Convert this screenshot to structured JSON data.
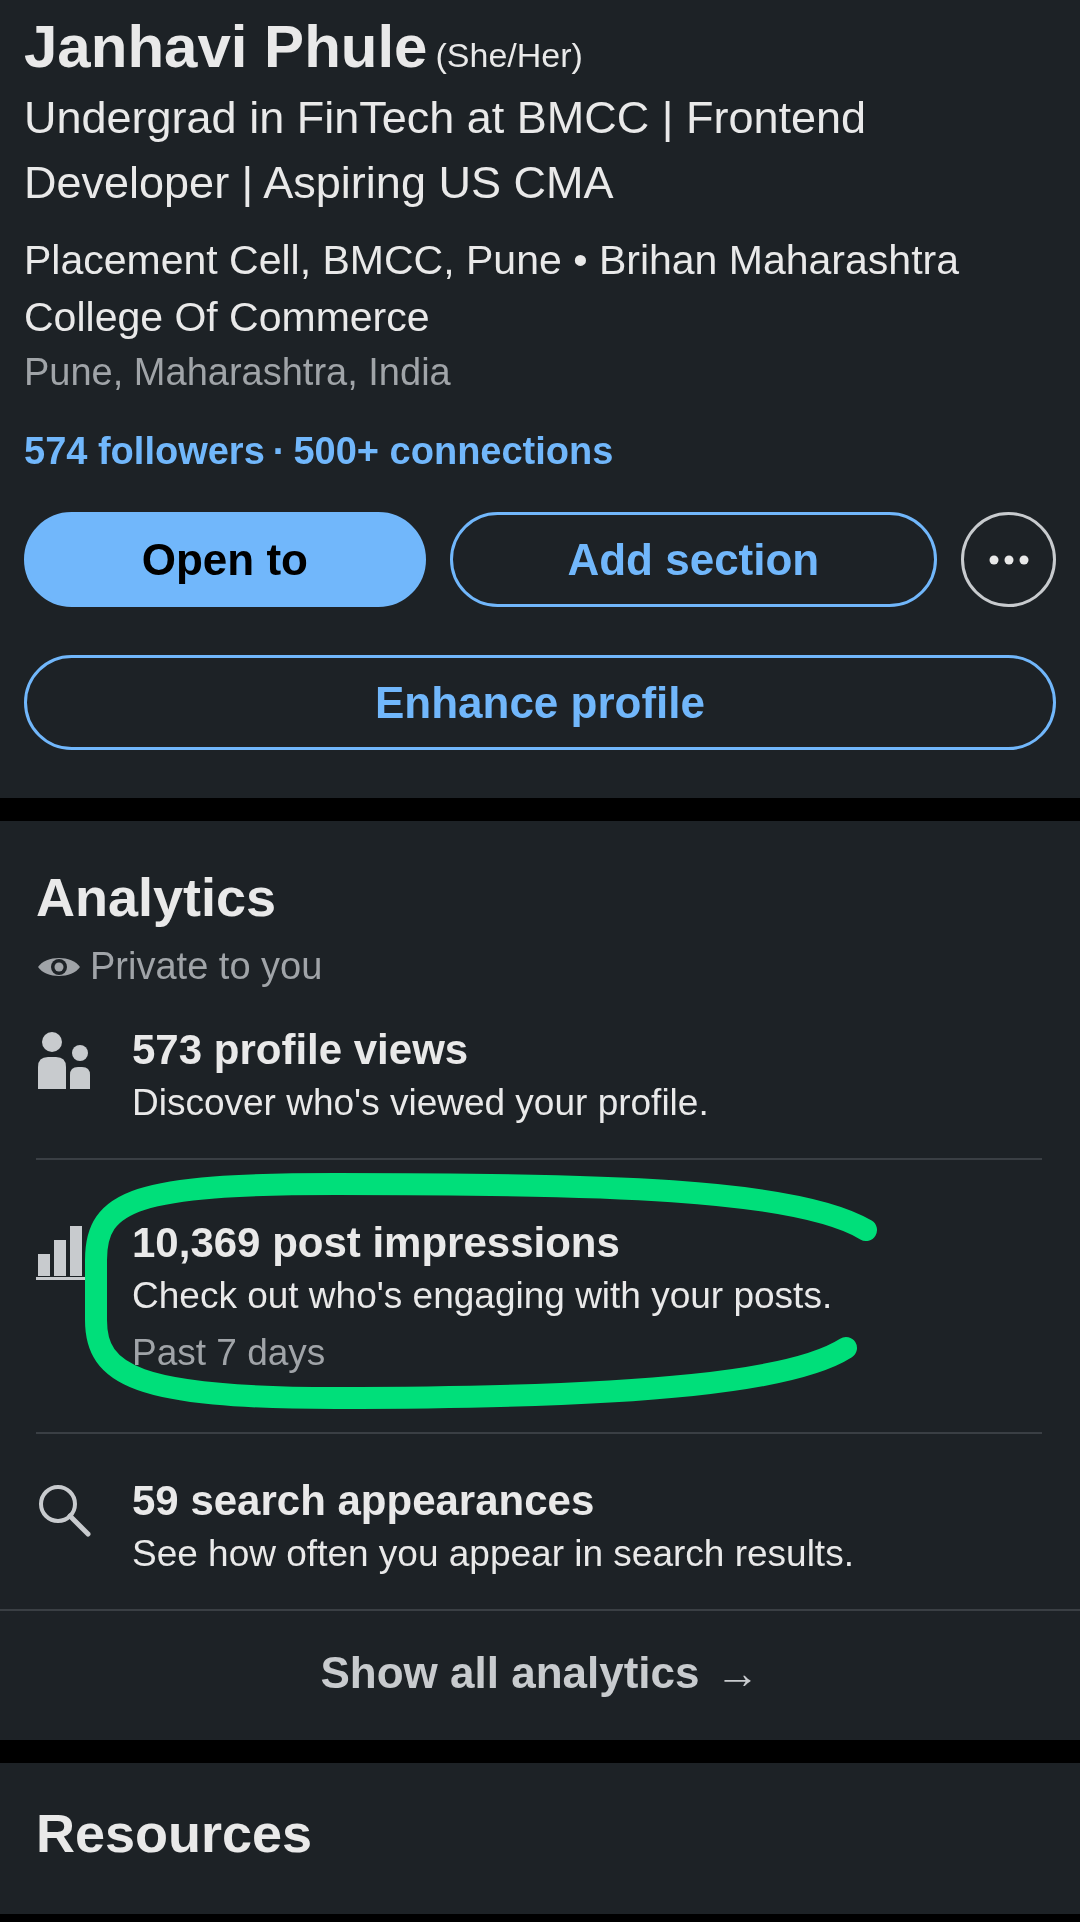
{
  "profile": {
    "name": "Janhavi Phule",
    "pronouns": "(She/Her)",
    "headline": "Undergrad in FinTech at BMCC | Frontend Developer | Aspiring US CMA",
    "organization": "Placement Cell, BMCC, Pune • Brihan Maharashtra College Of Commerce",
    "location": "Pune, Maharashtra, India",
    "followers": "574 followers",
    "separator": "·",
    "connections": "500+ connections",
    "buttons": [
      {
        "kind": "primary",
        "label": "Open to"
      },
      {
        "kind": "outline",
        "label": "Add section"
      },
      {
        "kind": "more"
      }
    ],
    "wide_button": {
      "kind": "outline",
      "label": "Enhance profile"
    }
  },
  "analytics": {
    "title": "Analytics",
    "visibility": "Private to you",
    "items": [
      {
        "kind": "people",
        "title": "573 profile views",
        "description": "Discover who's viewed your profile."
      },
      {
        "kind": "chart",
        "title": "10,369 post impressions",
        "description": "Check out who's engaging with your posts.",
        "note": "Past 7 days"
      },
      {
        "kind": "search",
        "title": "59 search appearances",
        "description": "See how often you appear in search results."
      }
    ],
    "footer": {
      "label": "Show all analytics",
      "arrow": "→"
    },
    "annotation": {
      "kind": "loop"
    }
  },
  "resources": {
    "title": "Resources"
  }
}
